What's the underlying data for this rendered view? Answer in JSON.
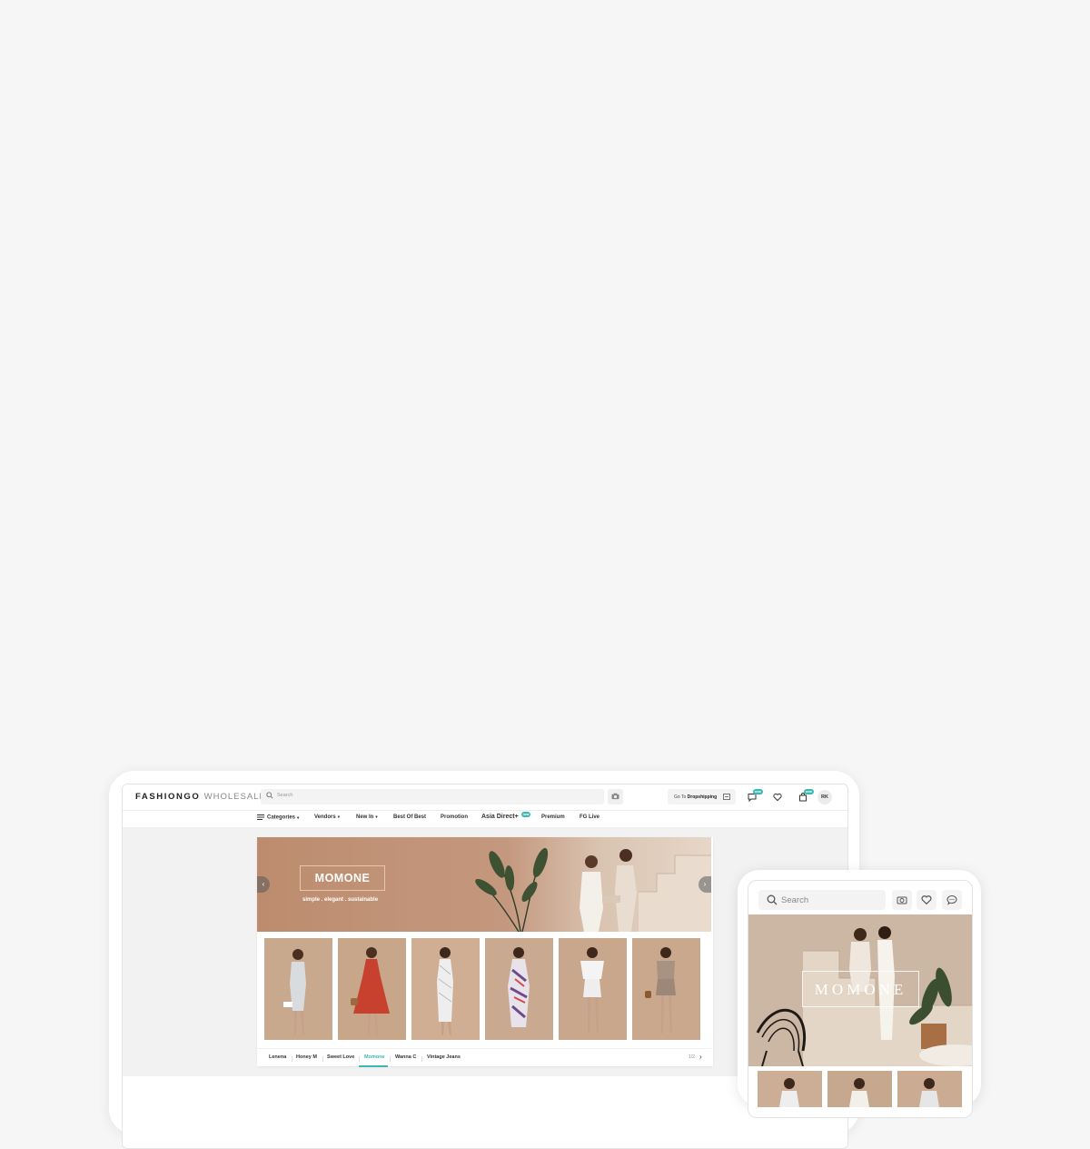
{
  "desktop": {
    "logo": {
      "bold": "FASHIONGO",
      "light": "WHOLESALE"
    },
    "search": {
      "placeholder": "Search"
    },
    "dropshipping": {
      "prefix": "Go To",
      "label": "Dropshipping"
    },
    "badges": {
      "messages": "new",
      "cart": "new",
      "asia": "new"
    },
    "avatar": "RK",
    "nav": {
      "categories": "Categories",
      "vendors": "Vendors",
      "new_in": "New In",
      "best_of_best": "Best Of Best",
      "promotion": "Promotion",
      "asia_direct": "Asia Direct+",
      "premium": "Premium",
      "fg_live": "FG Live",
      "caret": "▾"
    },
    "hero": {
      "brand": "MOMONE",
      "tagline": "simple . elegant . sustainable",
      "prev": "‹",
      "next": "›"
    },
    "vendor_tabs": [
      "Lenena",
      "Honey M",
      "Sweet Love",
      "Momone",
      "Wanna C",
      "Vintage Jeans"
    ],
    "active_tab": "Momone",
    "pager": "1/2",
    "pager_next": "›",
    "colors": {
      "accent": "#3bb8b3",
      "hero_bg": "#c08f72",
      "product_bg": "#c9a98e"
    }
  },
  "mobile": {
    "search": {
      "placeholder": "Search"
    },
    "hero": {
      "brand": "MOMONE"
    }
  }
}
